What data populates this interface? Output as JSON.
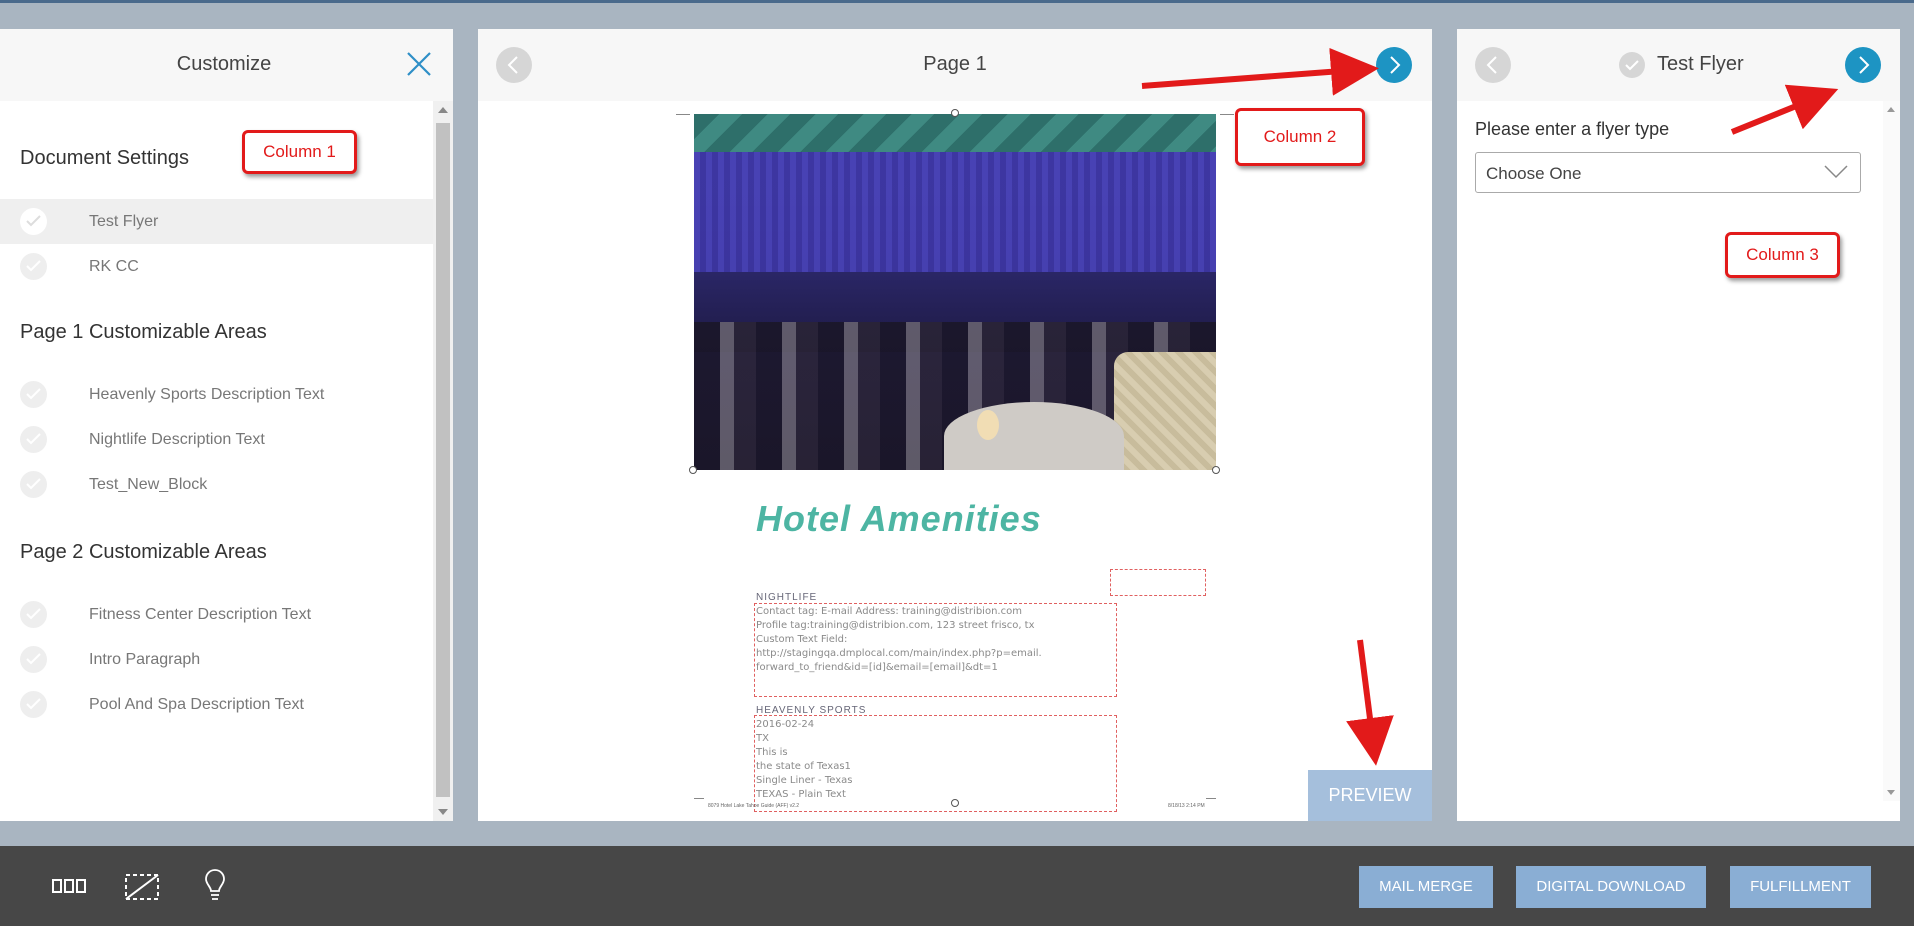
{
  "column1": {
    "title": "Customize",
    "sections": [
      {
        "heading": "Document Settings",
        "items": [
          {
            "label": "Test Flyer",
            "selected": true
          },
          {
            "label": "RK CC",
            "selected": false
          }
        ]
      },
      {
        "heading": "Page 1 Customizable Areas",
        "items": [
          {
            "label": "Heavenly Sports Description Text"
          },
          {
            "label": "Nightlife Description Text"
          },
          {
            "label": "Test_New_Block"
          }
        ]
      },
      {
        "heading": "Page 2 Customizable Areas",
        "items": [
          {
            "label": "Fitness Center Description Text"
          },
          {
            "label": "Intro Paragraph"
          },
          {
            "label": "Pool And Spa Description Text"
          }
        ]
      }
    ]
  },
  "column2": {
    "title": "Page 1",
    "document": {
      "heading": "Hotel Amenities",
      "nightlife_label": "NIGHTLIFE",
      "nightlife_lines": [
        "Contact tag: E-mail Address: training@distribion.com",
        "Profile tag:training@distribion.com, 123 street frisco, tx",
        "Custom Text Field:",
        "http://stagingqa.dmplocal.com/main/index.php?p=email.",
        "forward_to_friend&id=[id]&email=[email]&dt=1"
      ],
      "sports_label": "HEAVENLY SPORTS",
      "sports_lines": [
        "2016-02-24",
        "TX",
        "This is",
        "the state of Texas1",
        "Single Liner - Texas",
        "TEXAS - Plain Text"
      ],
      "footer_left": "8079 Hotel Lake Tahoe Guide (AFF) v2.2",
      "footer_right": "8/18/13 2:14 PM"
    },
    "preview_label": "PREVIEW"
  },
  "column3": {
    "title": "Test Flyer",
    "field_label": "Please enter a flyer type",
    "select_value": "Choose One"
  },
  "annotations": {
    "column1": "Column 1",
    "column2": "Column 2",
    "column3": "Column 3"
  },
  "bottom_bar": {
    "buttons": {
      "mail_merge": "MAIL MERGE",
      "digital_download": "DIGITAL DOWNLOAD",
      "fulfillment": "FULFILLMENT"
    }
  },
  "colors": {
    "accent_blue": "#1d94c3",
    "button_blue": "#8aaed4",
    "preview_blue": "#a5bfdc",
    "annotation_red": "#e21a1a",
    "heading_teal": "#4db5a3",
    "bottom_bar": "#474747"
  }
}
